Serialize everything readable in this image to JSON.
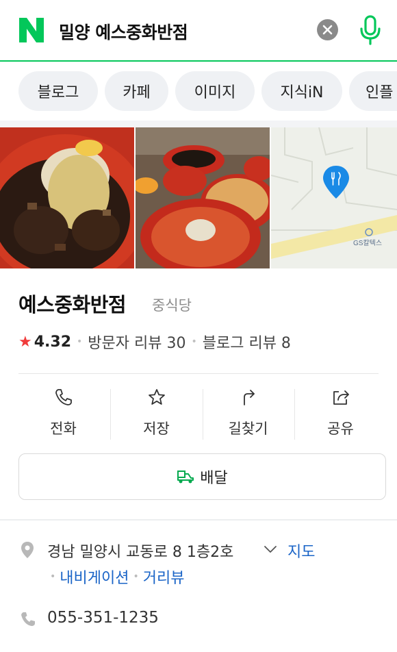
{
  "search": {
    "logo_letter": "N",
    "query": "밀양 예스중화반점"
  },
  "tabs": [
    {
      "label": "블로그"
    },
    {
      "label": "카페"
    },
    {
      "label": "이미지"
    },
    {
      "label": "지식iN"
    },
    {
      "label": "인플"
    }
  ],
  "map_photo": {
    "poi_label": "GS칼텍스"
  },
  "place": {
    "name": "예스중화반점",
    "category": "중식당",
    "rating": "4.32",
    "visitor_reviews": "방문자 리뷰 30",
    "blog_reviews": "블로그 리뷰 8"
  },
  "actions": [
    {
      "label": "전화",
      "icon": "phone-icon"
    },
    {
      "label": "저장",
      "icon": "star-outline-icon"
    },
    {
      "label": "길찾기",
      "icon": "directions-icon"
    },
    {
      "label": "공유",
      "icon": "share-icon"
    }
  ],
  "delivery": {
    "label": "배달"
  },
  "address": {
    "text": "경남 밀양시 교동로 8 1층2호",
    "map_link": "지도",
    "navigation_link": "내비게이션",
    "streetview_link": "거리뷰"
  },
  "phone": {
    "number": "055-351-1235"
  },
  "colors": {
    "naver_green": "#03c75a",
    "link_blue": "#1a64c7",
    "star_red": "#f03b3b"
  }
}
